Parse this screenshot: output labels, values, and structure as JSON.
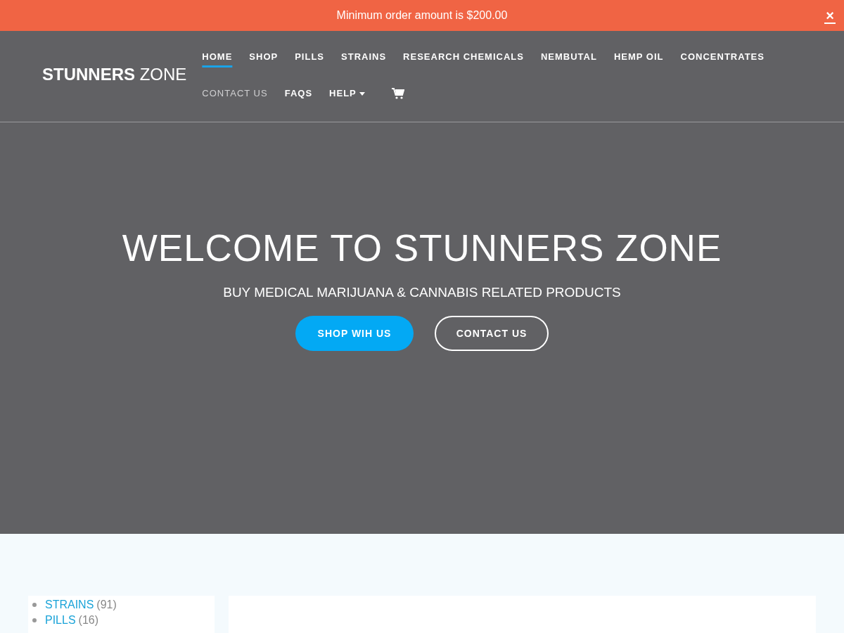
{
  "notice": {
    "text": "Minimum order amount is $200.00",
    "close": "×"
  },
  "logo": {
    "bold": "STUNNERS",
    "light": "ZONE"
  },
  "nav": [
    {
      "label": "HOME",
      "selected": true,
      "muted": false,
      "kind": "link"
    },
    {
      "label": "SHOP",
      "selected": false,
      "muted": false,
      "kind": "link"
    },
    {
      "label": "PILLS",
      "selected": false,
      "muted": false,
      "kind": "link"
    },
    {
      "label": "STRAINS",
      "selected": false,
      "muted": false,
      "kind": "link"
    },
    {
      "label": "RESEARCH CHEMICALS",
      "selected": false,
      "muted": false,
      "kind": "link"
    },
    {
      "label": "NEMBUTAL",
      "selected": false,
      "muted": false,
      "kind": "link"
    },
    {
      "label": "HEMP OIL",
      "selected": false,
      "muted": false,
      "kind": "link"
    },
    {
      "label": "CONCENTRATES",
      "selected": false,
      "muted": false,
      "kind": "link"
    },
    {
      "label": "CONTACT US",
      "selected": false,
      "muted": true,
      "kind": "link"
    },
    {
      "label": "FAQS",
      "selected": false,
      "muted": false,
      "kind": "link"
    },
    {
      "label": "HELP",
      "selected": false,
      "muted": false,
      "kind": "dropdown"
    }
  ],
  "hero": {
    "title": "WELCOME TO STUNNERS ZONE",
    "subtitle": "BUY MEDICAL MARIJUANA & CANNABIS RELATED PRODUCTS",
    "buttons": [
      {
        "label": "SHOP WIH US",
        "kind": "primary"
      },
      {
        "label": "CONTACT US",
        "kind": "outline"
      }
    ]
  },
  "categories": [
    {
      "name": "STRAINS",
      "count": "(91)"
    },
    {
      "name": "PILLS",
      "count": "(16)"
    }
  ]
}
